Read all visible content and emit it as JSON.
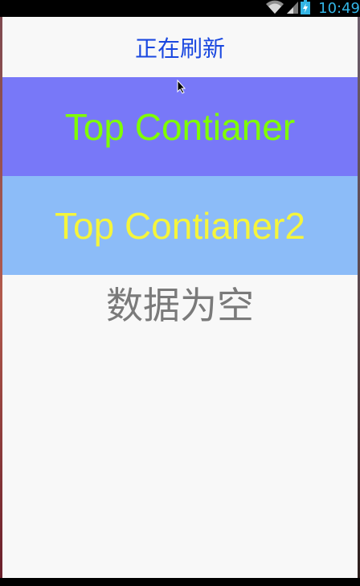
{
  "status_bar": {
    "time": "10:49",
    "icons": [
      "wifi-icon",
      "signal-icon",
      "battery-charging-icon"
    ]
  },
  "refresh_header": {
    "text": "正在刷新"
  },
  "containers": [
    {
      "label": "Top Contianer",
      "color": "#7fff00",
      "background": "#7878f8"
    },
    {
      "label": "Top Contianer2",
      "color": "#f5f53c",
      "background": "#8cbcf8"
    }
  ],
  "empty_state": {
    "text": "数据为空"
  },
  "colors": {
    "status_accent": "#33b5e5",
    "refresh_text": "#1a48e0",
    "empty_text": "#7a7a7a",
    "app_background": "#f8f8f8"
  }
}
